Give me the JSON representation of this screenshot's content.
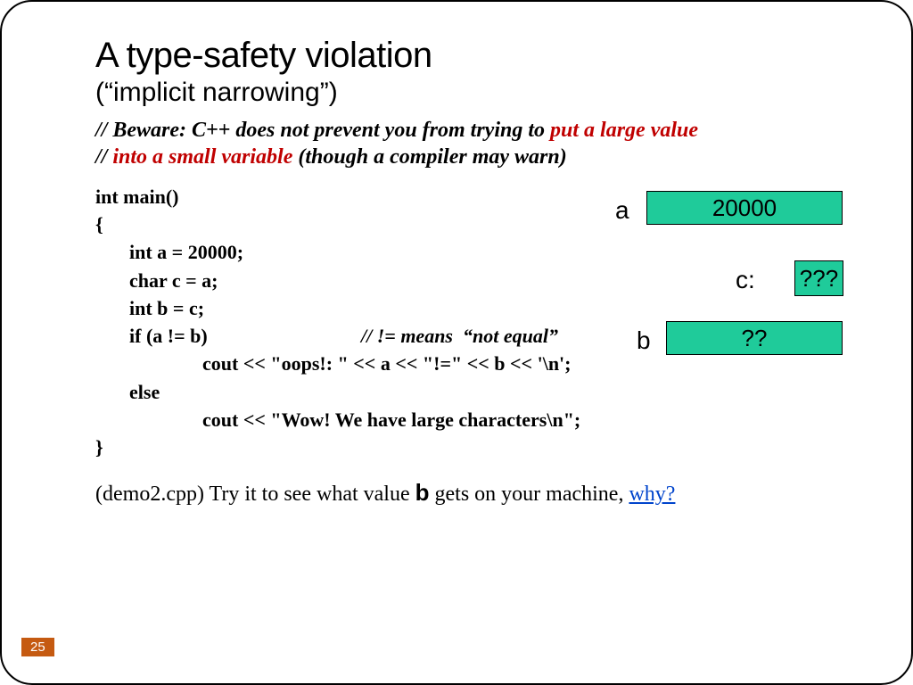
{
  "title": "A type-safety violation",
  "subtitle": "(“implicit narrowing”)",
  "comment": {
    "prefix1": "// Beware: C++ does not prevent you from trying to ",
    "red1": "put a large value",
    "prefix2": "// ",
    "red2": "into a small variable",
    "suffix2": " (though a compiler may warn)"
  },
  "code": {
    "l1": "int main()",
    "l2": "{",
    "l3": "int a = 20000;",
    "l4": "char c = a;",
    "l5": "int b = c;",
    "l6a": "if (a != b)",
    "l6b": "//  != means  “not equal”",
    "l7": "cout << \"oops!: \" << a << \"!=\" << b << '\\n';",
    "l8": "else",
    "l9": "cout << \"Wow! We have large characters\\n\";",
    "l10": "}"
  },
  "note": {
    "pre": "(demo2.cpp) Try it to see what value ",
    "var": "b",
    "post": " gets on your machine, ",
    "link": "why?"
  },
  "diagram": {
    "a_label": "a",
    "a_value": "20000",
    "c_label": "c:",
    "c_value": "???",
    "b_label": "b",
    "b_value": "??"
  },
  "page": "25"
}
